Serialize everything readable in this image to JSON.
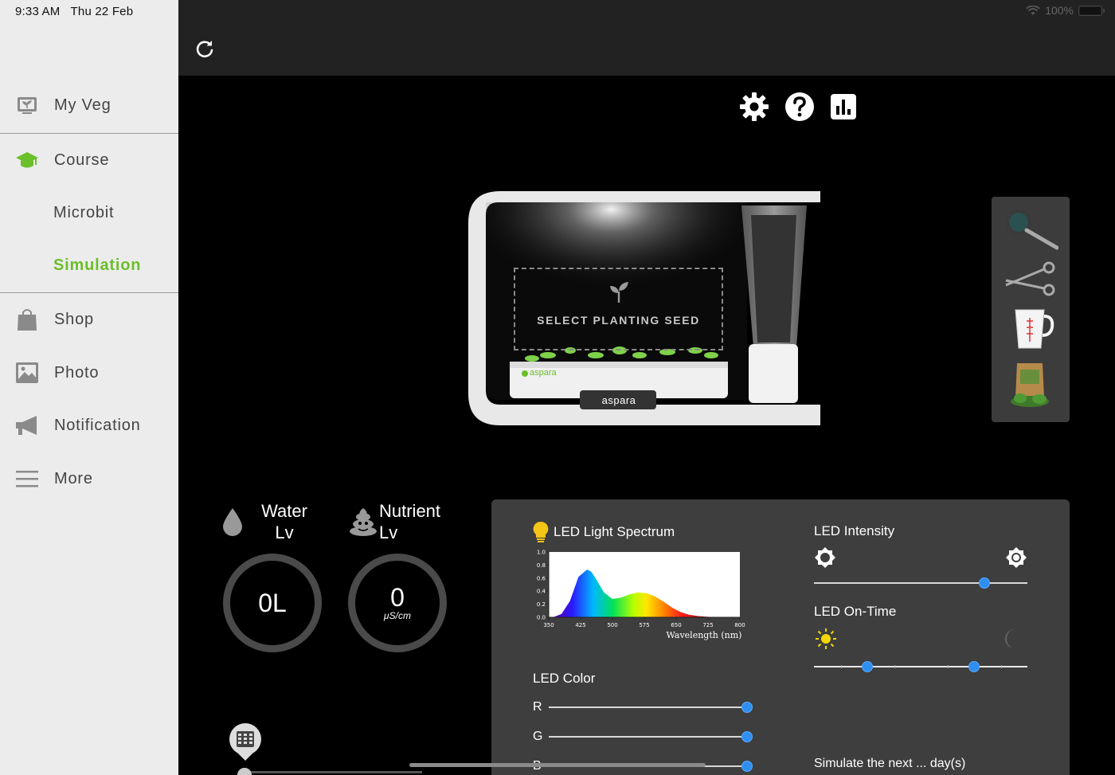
{
  "status_bar": {
    "time": "9:33 AM",
    "date": "Thu 22 Feb",
    "battery": "100%"
  },
  "sidebar": {
    "items": [
      {
        "label": "My Veg",
        "icon": "monitor-plant-icon"
      },
      {
        "label": "Course",
        "icon": "graduation-cap-icon"
      },
      {
        "label": "Microbit",
        "icon": ""
      },
      {
        "label": "Simulation",
        "icon": "",
        "active": true
      },
      {
        "label": "Shop",
        "icon": "shopping-bag-icon"
      },
      {
        "label": "Photo",
        "icon": "photo-icon"
      },
      {
        "label": "Notification",
        "icon": "megaphone-icon"
      },
      {
        "label": "More",
        "icon": "menu-icon"
      }
    ]
  },
  "toolbar": {
    "refresh_icon": "refresh-icon",
    "settings_icon": "gear-icon",
    "help_icon": "help-icon",
    "stats_icon": "bar-chart-icon"
  },
  "device": {
    "select_seed": "SELECT PLANTING SEED",
    "brand_small": "aspara",
    "brand_badge": "aspara"
  },
  "tools": [
    "magnifier-icon",
    "scissors-icon",
    "measuring-cup-icon",
    "seed-bag-icon"
  ],
  "levels": {
    "water": {
      "label_1": "Water",
      "label_2": "Lv",
      "value": "0L"
    },
    "nutrient": {
      "label_1": "Nutrient",
      "label_2": "Lv",
      "value": "0",
      "unit": "μS/cm"
    }
  },
  "led": {
    "spectrum_title": "LED Light Spectrum",
    "intensity_title": "LED Intensity",
    "intensity_value": 0.8,
    "ontime_title": "LED On-Time",
    "ontime_start": 0.25,
    "ontime_end": 0.75,
    "color_title": "LED Color",
    "channels": [
      {
        "label": "R",
        "value": 1.0
      },
      {
        "label": "G",
        "value": 1.0
      },
      {
        "label": "B",
        "value": 1.0
      }
    ],
    "simulate_label": "Simulate the next ... day(s)"
  },
  "chart_data": {
    "type": "area",
    "xlabel": "Wavelength (nm)",
    "ylabel": "",
    "xlim": [
      350,
      800
    ],
    "ylim": [
      0,
      1.0
    ],
    "x_ticks": [
      "350",
      "425",
      "500",
      "575",
      "650",
      "725",
      "800"
    ],
    "y_ticks": [
      "0.0",
      "0.2",
      "0.4",
      "0.6",
      "0.8",
      "1.0"
    ],
    "x": [
      360,
      380,
      400,
      420,
      440,
      450,
      460,
      480,
      500,
      520,
      540,
      560,
      580,
      600,
      620,
      640,
      660,
      680,
      700,
      720,
      740
    ],
    "values": [
      0.0,
      0.05,
      0.25,
      0.62,
      0.73,
      0.7,
      0.6,
      0.38,
      0.28,
      0.3,
      0.35,
      0.38,
      0.37,
      0.32,
      0.24,
      0.15,
      0.08,
      0.04,
      0.02,
      0.01,
      0.0
    ],
    "grid": false
  }
}
